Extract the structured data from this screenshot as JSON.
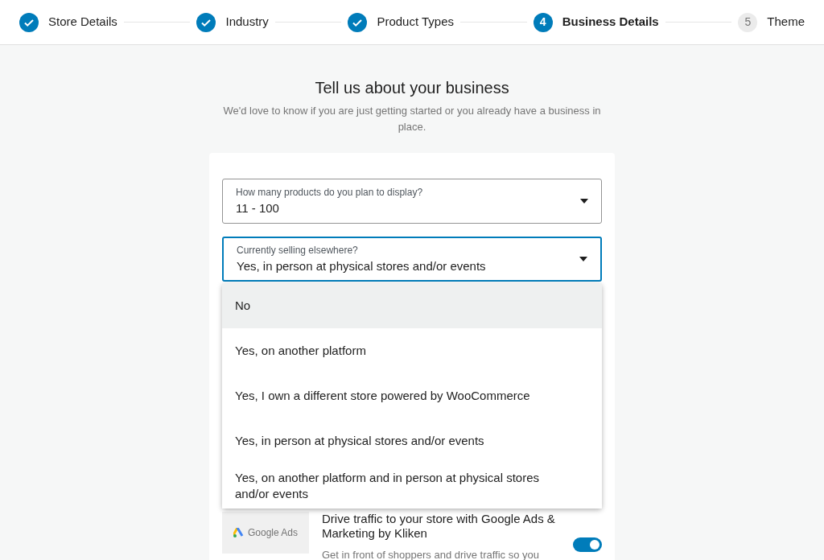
{
  "steps": [
    {
      "label": "Store Details",
      "kind": "done"
    },
    {
      "label": "Industry",
      "kind": "done"
    },
    {
      "label": "Product Types",
      "kind": "done"
    },
    {
      "label": "Business Details",
      "kind": "current",
      "number": "4"
    },
    {
      "label": "Theme",
      "kind": "upcoming",
      "number": "5"
    }
  ],
  "heading": "Tell us about your business",
  "subheading": "We'd love to know if you are just getting started or you already have a business in place.",
  "fields": [
    {
      "label": "How many products do you plan to display?",
      "value": "11 - 100",
      "focused": false
    },
    {
      "label": "Currently selling elsewhere?",
      "value": "Yes, in person at physical stores and/or events",
      "focused": true
    }
  ],
  "dropdown_options": [
    {
      "label": "No",
      "selected": true
    },
    {
      "label": "Yes, on another platform",
      "selected": false
    },
    {
      "label": "Yes, I own a different store powered by WooCommerce",
      "selected": false
    },
    {
      "label": "Yes, in person at physical stores and/or events",
      "selected": false
    },
    {
      "label": "Yes, on another platform and in person at physical stores and/or events",
      "selected": false
    }
  ],
  "extension": {
    "logo_text": "Google Ads",
    "title": "Drive traffic to your store with Google Ads & Marketing by Kliken",
    "description": "Get in front of shoppers and drive traffic so you",
    "on": true
  }
}
